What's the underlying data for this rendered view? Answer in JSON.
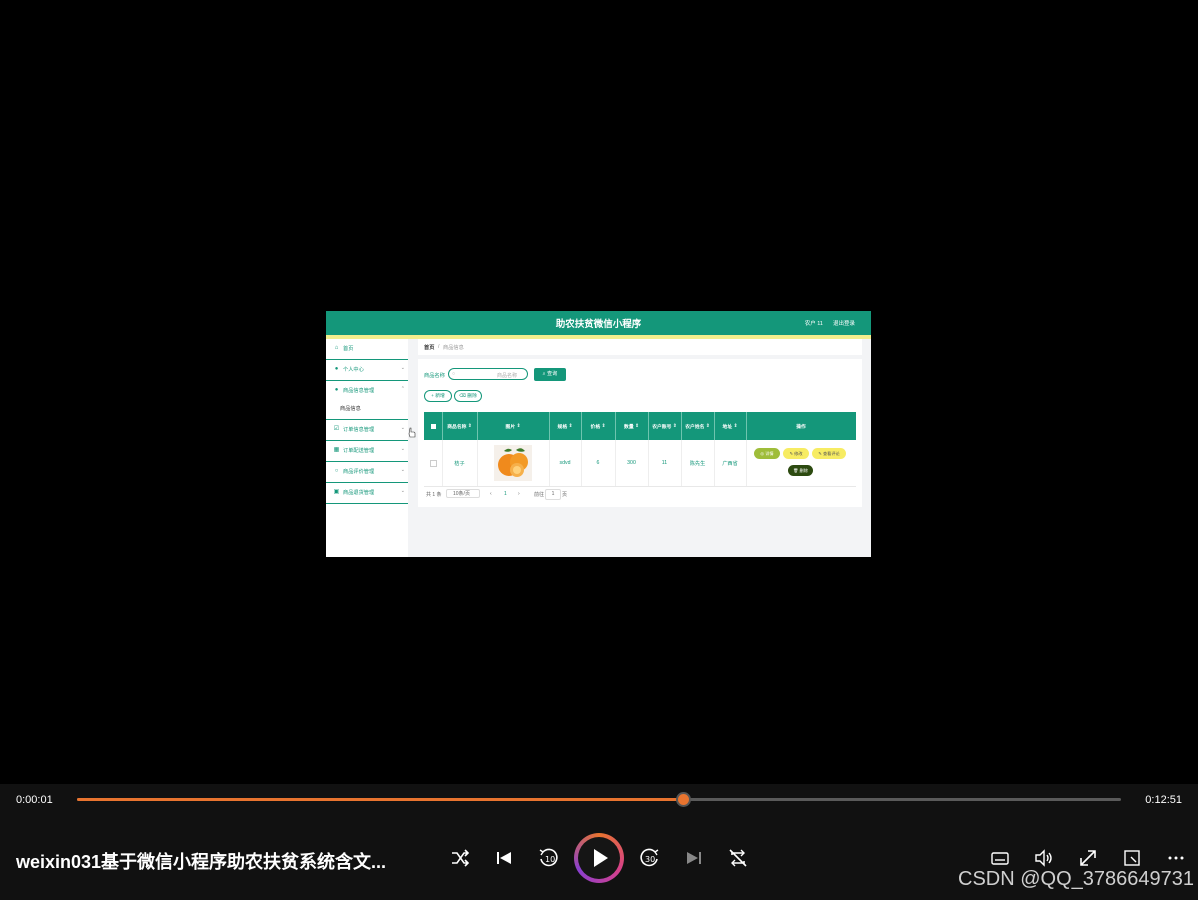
{
  "app": {
    "title": "助农扶贫微信小程序",
    "user_label": "农户 11",
    "logout_label": "退出登录"
  },
  "sidebar": {
    "items": [
      {
        "label": "首页",
        "icon": "home-icon"
      },
      {
        "label": "个人中心",
        "icon": "user-icon"
      },
      {
        "label": "商品信息管理",
        "icon": "user-icon"
      },
      {
        "label": "订单信息管理",
        "icon": "order-icon"
      },
      {
        "label": "订单配送管理",
        "icon": "delivery-icon"
      },
      {
        "label": "商品评价管理",
        "icon": "comment-icon"
      },
      {
        "label": "商品退货管理",
        "icon": "lock-icon"
      }
    ],
    "submenu_label": "商品信息"
  },
  "breadcrumb": {
    "home": "首页",
    "separator": "/",
    "current": "商品信息"
  },
  "search": {
    "label": "商品名称",
    "placeholder": "商品名称",
    "query_label": "查询"
  },
  "toolbar": {
    "add_label": "+ 新增",
    "delete_label": "删除"
  },
  "table": {
    "headers": [
      "商品名称",
      "图片",
      "规格",
      "价格",
      "数量",
      "农户账号",
      "农户姓名",
      "地址",
      "操作"
    ],
    "rows": [
      {
        "name": "桔子",
        "spec": "sdvd",
        "price": "6",
        "quantity": "300",
        "farmer_account": "11",
        "farmer_name": "陈先生",
        "address": "广西省"
      }
    ],
    "actions": {
      "detail": "详情",
      "edit": "修改",
      "view_comments": "查看评论",
      "delete": "删除"
    }
  },
  "pagination": {
    "total": "共 1 条",
    "page_size": "10条/页",
    "current_page": "1",
    "goto_label": "前往",
    "goto_value": "1",
    "page_unit": "页"
  },
  "player": {
    "current_time": "0:00:01",
    "total_time": "0:12:51",
    "progress_fraction": 0.58,
    "title": "weixin031基于微信小程序助农扶贫系统含文...",
    "accent_color": "#e8742f"
  },
  "watermark": "CSDN @QQ_3786649731"
}
